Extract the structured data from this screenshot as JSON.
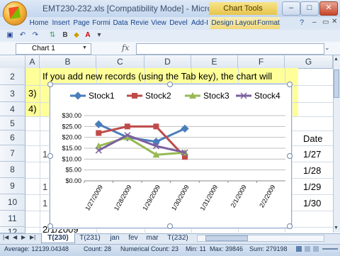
{
  "window": {
    "title": "EMT230-232.xls  [Compatibility Mode] - Microsoft E...",
    "chart_tools": "Chart Tools",
    "minimize": "–",
    "maximize": "□",
    "close": "✕"
  },
  "ribbon": {
    "tabs": [
      "Home",
      "Insert",
      "Page",
      "Formi",
      "Data",
      "Revie",
      "View",
      "Devel",
      "Add-I",
      "Design",
      "Layout",
      "Format"
    ]
  },
  "formula_bar": {
    "name_box": "Chart 1",
    "fx": "fx",
    "value": ""
  },
  "grid": {
    "columns": [
      "A",
      "B",
      "C",
      "D",
      "E",
      "F",
      "G"
    ],
    "rows": [
      "2",
      "3",
      "4",
      "5",
      "6",
      "7",
      "8",
      "9",
      "10",
      "11",
      "12"
    ],
    "row2_text": "If you add new records (using the Tab key), the chart will",
    "row3_label": "3)",
    "row4_label": "4)",
    "row12_date": "2/1/2009",
    "g_column": [
      "Date",
      "1/27",
      "1/28",
      "1/29",
      "1/30"
    ],
    "b_column_fragments": [
      "1",
      "1",
      "1"
    ]
  },
  "sheet_tabs": {
    "tabs": [
      "T(230)",
      "T(231)",
      "jan",
      "fev",
      "mar",
      "T(232)"
    ],
    "active": "T(230)"
  },
  "status_bar": {
    "average": "Average: 12139.04348",
    "count": "Count: 28",
    "numerical_count": "Numerical Count: 23",
    "min": "Min: 11",
    "max": "Max: 39846",
    "sum": "Sum: 279198"
  },
  "colors": {
    "stock1": "#4a7ebb",
    "stock2": "#be4b48",
    "stock3": "#98b954",
    "stock4": "#7d60a0"
  },
  "chart_data": {
    "type": "line",
    "categories": [
      "1/27/2009",
      "1/28/2009",
      "1/29/2009",
      "1/30/2009",
      "1/31/2009",
      "2/1/2009",
      "2/2/2009"
    ],
    "series": [
      {
        "name": "Stock1",
        "values": [
          26,
          20,
          18,
          24,
          null,
          null,
          null
        ]
      },
      {
        "name": "Stock2",
        "values": [
          22,
          25,
          25,
          11,
          null,
          null,
          null
        ]
      },
      {
        "name": "Stock3",
        "values": [
          16,
          20,
          12,
          13,
          null,
          null,
          null
        ]
      },
      {
        "name": "Stock4",
        "values": [
          14,
          21,
          16,
          13,
          null,
          null,
          null
        ]
      }
    ],
    "ylim": [
      0,
      30
    ],
    "yticks": [
      "$0.00",
      "$5.00",
      "$10.00",
      "$15.00",
      "$20.00",
      "$25.00",
      "$30.00"
    ],
    "legend": "top",
    "grid": true
  }
}
